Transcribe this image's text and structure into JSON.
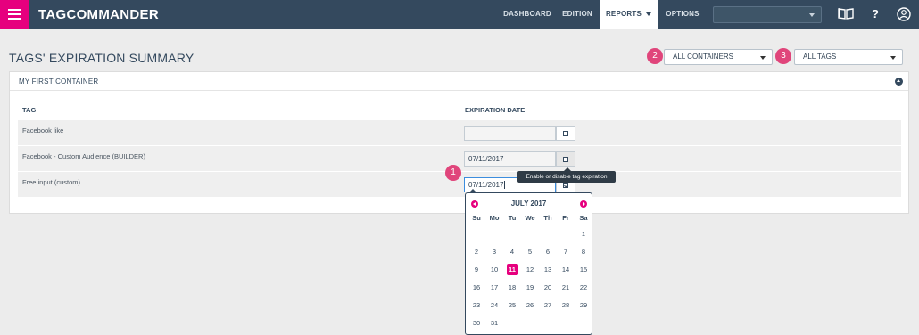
{
  "app": {
    "name": "TAGCOMMANDER"
  },
  "nav": [
    {
      "label": "DASHBOARD"
    },
    {
      "label": "EDITION"
    },
    {
      "label": "REPORTS"
    },
    {
      "label": "OPTIONS"
    }
  ],
  "page": {
    "title": "TAGS' EXPIRATION SUMMARY"
  },
  "filters": {
    "containers": {
      "value": "ALL CONTAINERS",
      "badge": "2"
    },
    "tags": {
      "value": "ALL TAGS",
      "badge": "3"
    }
  },
  "container": {
    "title": "MY FIRST CONTAINER",
    "columns": {
      "tag": "TAG",
      "expiration": "EXPIRATION DATE"
    },
    "rows": [
      {
        "tag": "Facebook like",
        "date": "",
        "enabled": false
      },
      {
        "tag": "Facebook - Custom Audience (BUILDER)",
        "date": "07/11/2017",
        "enabled": false
      },
      {
        "tag": "Free input (custom)",
        "date": "07/11/2017",
        "enabled": true
      }
    ]
  },
  "annotation": {
    "badge": "1"
  },
  "tooltip": "Enable or disable tag expiration",
  "datepicker": {
    "title": "JULY 2017",
    "weekdays": [
      "Su",
      "Mo",
      "Tu",
      "We",
      "Th",
      "Fr",
      "Sa"
    ],
    "weeks": [
      [
        "",
        "",
        "",
        "",
        "",
        "",
        "1"
      ],
      [
        "2",
        "3",
        "4",
        "5",
        "6",
        "7",
        "8"
      ],
      [
        "9",
        "10",
        "11",
        "12",
        "13",
        "14",
        "15"
      ],
      [
        "16",
        "17",
        "18",
        "19",
        "20",
        "21",
        "22"
      ],
      [
        "23",
        "24",
        "25",
        "26",
        "27",
        "28",
        "29"
      ],
      [
        "30",
        "31",
        "",
        "",
        "",
        "",
        ""
      ]
    ],
    "selected_day": "11"
  },
  "colors": {
    "topbar": "#34495e",
    "accent": "#e6007e",
    "badge": "#e0457b",
    "background": "#ececec"
  },
  "icons": {
    "menu": "hamburger-icon",
    "docs": "book-icon",
    "help": "question-icon",
    "account": "user-icon"
  }
}
